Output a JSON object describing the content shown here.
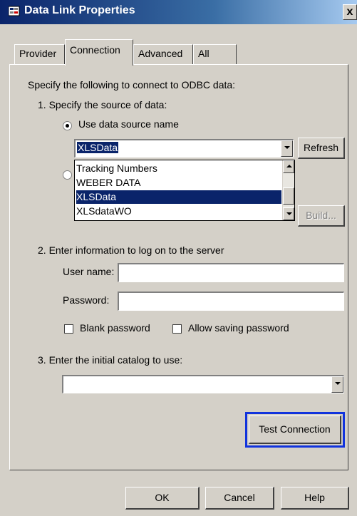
{
  "window": {
    "title": "Data Link Properties",
    "close_glyph": "x"
  },
  "tabs": [
    {
      "label": "Provider",
      "active": false
    },
    {
      "label": "Connection",
      "active": true
    },
    {
      "label": "Advanced",
      "active": false
    },
    {
      "label": "All",
      "active": false
    }
  ],
  "connection": {
    "intro": "Specify the following to connect to ODBC data:",
    "step1": {
      "label": "1. Specify the source of data:",
      "radio_dsn_label": "Use data source name",
      "dsn_value": "XLSData",
      "refresh_label": "Refresh",
      "dropdown_items": [
        "Tracking Numbers",
        "WEBER DATA",
        "XLSData",
        "XLSdataWO"
      ],
      "dropdown_selected": "XLSData",
      "build_label": "Build..."
    },
    "step2": {
      "label": "2. Enter information to log on to the server",
      "username_label": "User name:",
      "username_value": "",
      "password_label": "Password:",
      "password_value": "",
      "blank_password_label": "Blank password",
      "allow_saving_label": "Allow saving password"
    },
    "step3": {
      "label": "3. Enter the initial catalog to use:",
      "catalog_value": ""
    },
    "test_connection_label": "Test Connection"
  },
  "footer": {
    "ok_label": "OK",
    "cancel_label": "Cancel",
    "help_label": "Help"
  },
  "colors": {
    "dialog_bg": "#d4d0c8",
    "title_bar": "#0a246a",
    "selection": "#0a246a",
    "focus_frame": "#1133dd"
  }
}
